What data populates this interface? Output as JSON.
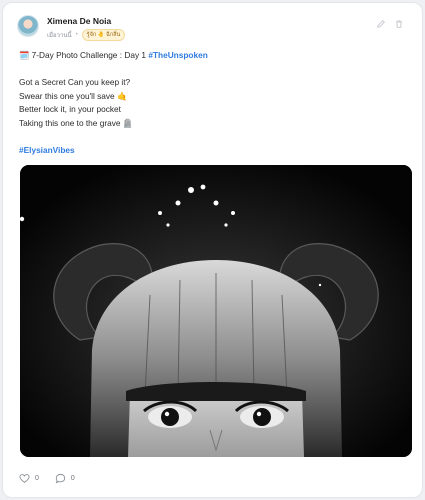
{
  "post": {
    "author": "Ximena De Noia",
    "time_label": "เมื่อวานนี้",
    "badge_label": "รู้จัก 🤚 ฉีกลึ่น",
    "lines": [
      {
        "prefix": "🗓️ 7-Day Photo Challenge : Day 1 ",
        "tag": "#TheUnspoken"
      },
      {
        "text": ""
      },
      {
        "text": "Got a Secret Can you keep it?"
      },
      {
        "text": "Swear this one you'll save 🤙"
      },
      {
        "text": "Better lock it, in your pocket"
      },
      {
        "text": "Taking this one to the grave 🪦"
      },
      {
        "text": ""
      },
      {
        "tag": "#ElysianVibes"
      }
    ],
    "likes": "0",
    "comments": "0"
  },
  "icons": {
    "edit": "pencil-icon",
    "delete": "trash-icon",
    "like": "heart-icon",
    "comment": "comment-icon"
  },
  "colors": {
    "hashtag": "#2f7be0",
    "icon_gray": "#c3c7cd",
    "photo_bg": "#050505"
  }
}
